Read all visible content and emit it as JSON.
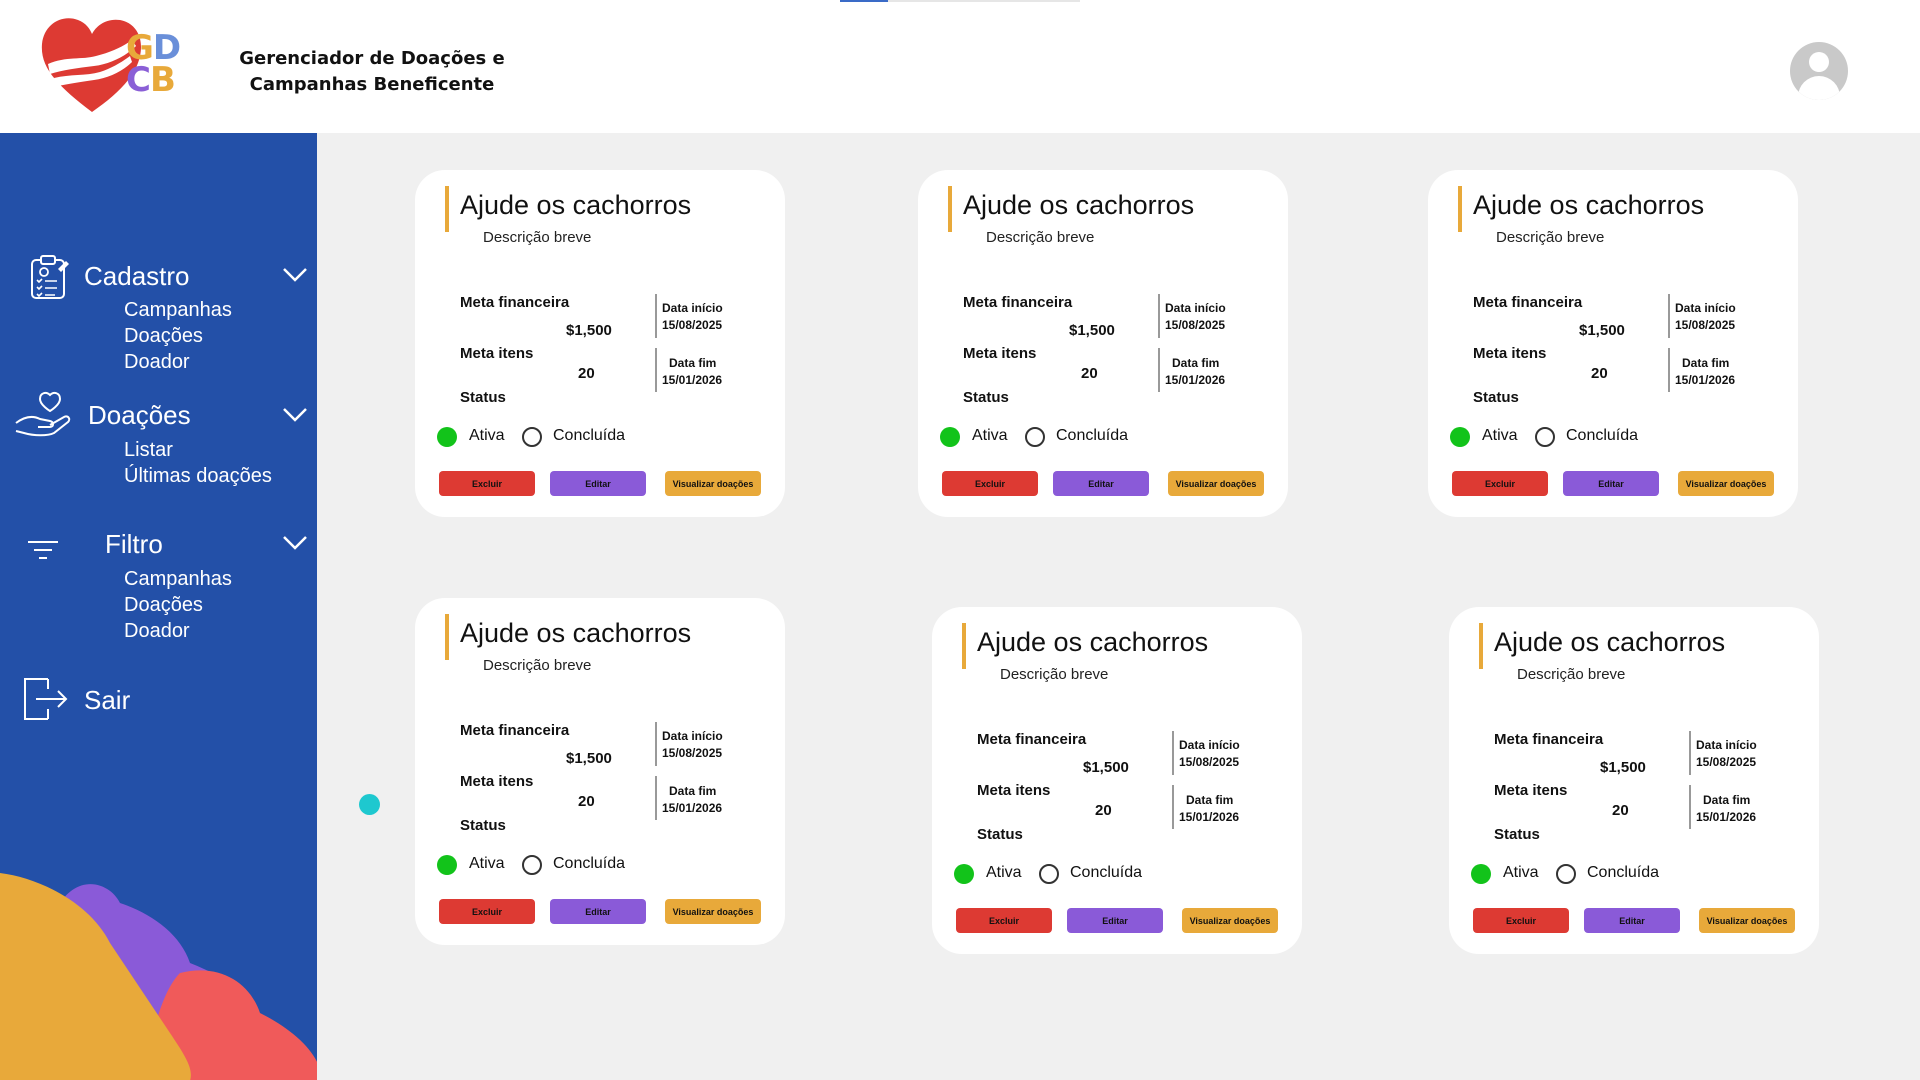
{
  "header": {
    "logo_letters": [
      "G",
      "D",
      "C",
      "B"
    ],
    "app_title_line1": "Gerenciador de Doações e",
    "app_title_line2": "Campanhas Beneficente"
  },
  "sidebar": {
    "sections": [
      {
        "title": "Cadastro",
        "icon": "clipboard-icon",
        "items": [
          "Campanhas",
          "Doações",
          "Doador"
        ]
      },
      {
        "title": "Doações",
        "icon": "hand-heart-icon",
        "items": [
          "Listar",
          "Últimas doações"
        ]
      },
      {
        "title": "Filtro",
        "icon": "filter-icon",
        "items": [
          "Campanhas",
          "Doações",
          "Doador"
        ]
      }
    ],
    "logout_label": "Sair"
  },
  "card_labels": {
    "meta_financeira": "Meta financeira",
    "meta_itens": "Meta itens",
    "status": "Status",
    "data_inicio": "Data início",
    "data_fim": "Data fim",
    "ativa": "Ativa",
    "concluida": "Concluída",
    "excluir": "Excluir",
    "editar": "Editar",
    "visualizar": "Visualizar doações"
  },
  "cards": [
    {
      "title": "Ajude os cachorros",
      "description": "Descrição breve",
      "meta_financeira": "$1,500",
      "meta_itens": "20",
      "data_inicio": "15/08/2025",
      "data_fim": "15/01/2026",
      "status": "Ativa"
    },
    {
      "title": "Ajude os cachorros",
      "description": "Descrição breve",
      "meta_financeira": "$1,500",
      "meta_itens": "20",
      "data_inicio": "15/08/2025",
      "data_fim": "15/01/2026",
      "status": "Ativa"
    },
    {
      "title": "Ajude os cachorros",
      "description": "Descrição breve",
      "meta_financeira": "$1,500",
      "meta_itens": "20",
      "data_inicio": "15/08/2025",
      "data_fim": "15/01/2026",
      "status": "Ativa"
    },
    {
      "title": "Ajude os cachorros",
      "description": "Descrição breve",
      "meta_financeira": "$1,500",
      "meta_itens": "20",
      "data_inicio": "15/08/2025",
      "data_fim": "15/01/2026",
      "status": "Ativa"
    },
    {
      "title": "Ajude os cachorros",
      "description": "Descrição breve",
      "meta_financeira": "$1,500",
      "meta_itens": "20",
      "data_inicio": "15/08/2025",
      "data_fim": "15/01/2026",
      "status": "Ativa"
    },
    {
      "title": "Ajude os cachorros",
      "description": "Descrição breve",
      "meta_financeira": "$1,500",
      "meta_itens": "20",
      "data_inicio": "15/08/2025",
      "data_fim": "15/01/2026",
      "status": "Ativa"
    }
  ],
  "colors": {
    "sidebar": "#2350a8",
    "accent_bar": "#e8a93a",
    "excluir": "#dd3a33",
    "editar": "#8a5ad8",
    "visualizar": "#e8a93a",
    "status_active": "#12c31a"
  }
}
